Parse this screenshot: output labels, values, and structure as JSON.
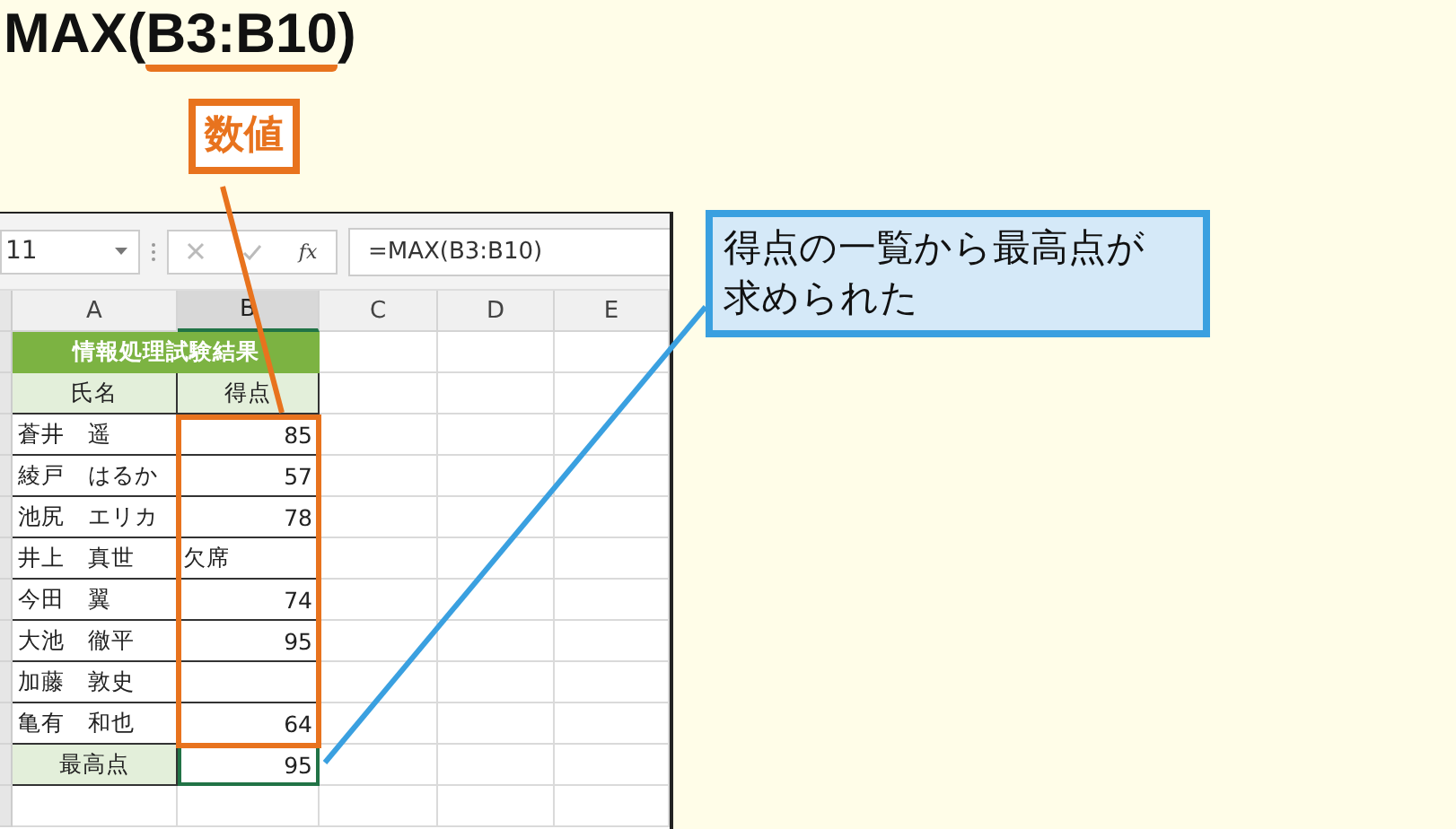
{
  "heading": {
    "prefix": "MAX(",
    "argument": "B3:B10",
    "suffix": ")"
  },
  "argument_label": "数値",
  "spreadsheet": {
    "name_box": "11",
    "function_button": "fx",
    "formula": "=MAX(B3:B10)",
    "columns": [
      {
        "label": "A",
        "selected": false
      },
      {
        "label": "B",
        "selected": true
      },
      {
        "label": "C",
        "selected": false
      },
      {
        "label": "D",
        "selected": false
      },
      {
        "label": "E",
        "selected": false
      }
    ],
    "title": "情報処理試験結果",
    "header": [
      "氏名",
      "得点"
    ],
    "rows": [
      {
        "name": "蒼井　遥",
        "score": "85",
        "kind": "number"
      },
      {
        "name": "綾戸　はるか",
        "score": "57",
        "kind": "number"
      },
      {
        "name": "池尻　エリカ",
        "score": "78",
        "kind": "number"
      },
      {
        "name": "井上　真世",
        "score": "欠席",
        "kind": "text"
      },
      {
        "name": "今田　翼",
        "score": "74",
        "kind": "number"
      },
      {
        "name": "大池　徹平",
        "score": "95",
        "kind": "number"
      },
      {
        "name": "加藤　敦史",
        "kind": "empty"
      },
      {
        "name": "亀有　和也",
        "score": "64",
        "kind": "number"
      }
    ],
    "result": {
      "label": "最高点",
      "value": "95",
      "selected": true
    }
  },
  "callout": "得点の一覧から最高点が求められた"
}
